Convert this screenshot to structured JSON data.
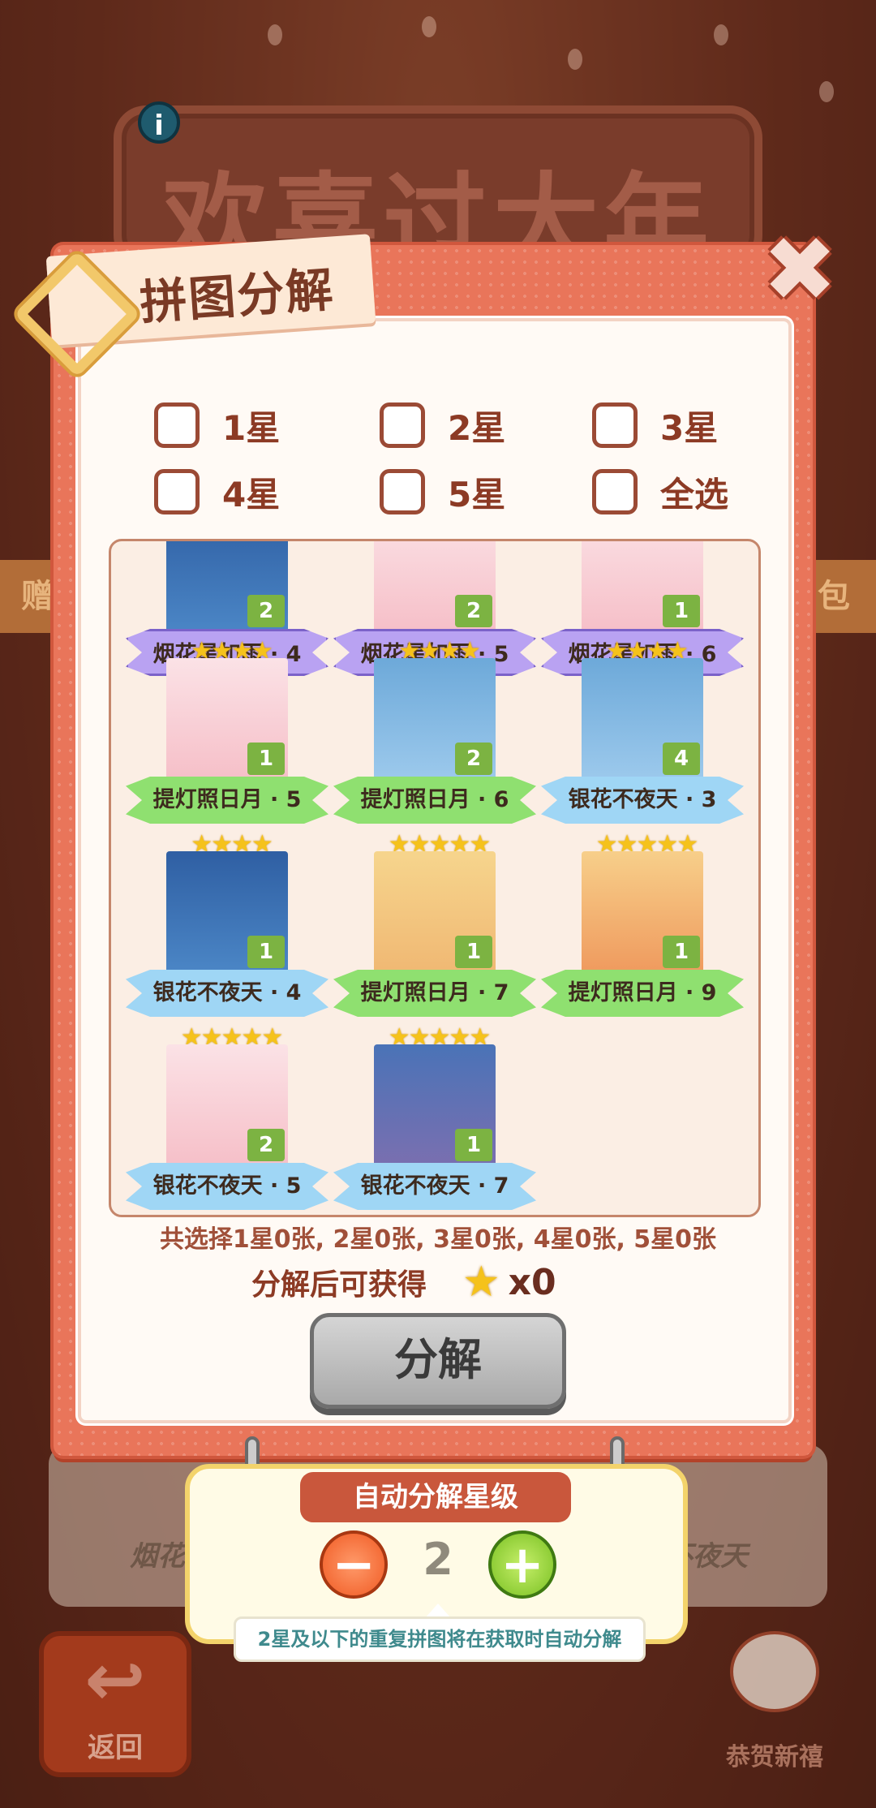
{
  "background": {
    "banner_title": "欢喜过大年",
    "info_icon": "i",
    "strip_left": "赠",
    "strip_right": "包",
    "card_label_left": "烟花星",
    "card_label_right": "不夜天",
    "back_label": "返回",
    "mascot_label": "恭贺新禧"
  },
  "modal": {
    "title": "拼图分解",
    "close_icon": "✖",
    "checkboxes": [
      {
        "label": "1星",
        "checked": false
      },
      {
        "label": "2星",
        "checked": false
      },
      {
        "label": "3星",
        "checked": false
      },
      {
        "label": "4星",
        "checked": false
      },
      {
        "label": "5星",
        "checked": false
      },
      {
        "label": "全选",
        "checked": false
      }
    ],
    "cards": [
      {
        "name": "烟花星如雨 · 4",
        "stars": "",
        "count": "2",
        "ribbon": "purple",
        "art": "night"
      },
      {
        "name": "烟花星如雨 · 5",
        "stars": "",
        "count": "2",
        "ribbon": "purple",
        "art": "pink"
      },
      {
        "name": "烟花星如雨 · 6",
        "stars": "",
        "count": "1",
        "ribbon": "purple",
        "art": "pink"
      },
      {
        "name": "提灯照日月 · 5",
        "stars": "★★★★",
        "count": "1",
        "ribbon": "green",
        "art": "pink"
      },
      {
        "name": "提灯照日月 · 6",
        "stars": "★★★★",
        "count": "2",
        "ribbon": "green",
        "art": "sky"
      },
      {
        "name": "银花不夜天 · 3",
        "stars": "★★★★",
        "count": "4",
        "ribbon": "blue",
        "art": "sky"
      },
      {
        "name": "银花不夜天 · 4",
        "stars": "★★★★",
        "count": "1",
        "ribbon": "blue",
        "art": "night"
      },
      {
        "name": "提灯照日月 · 7",
        "stars": "★★★★★",
        "count": "1",
        "ribbon": "green",
        "art": "warm"
      },
      {
        "name": "提灯照日月 · 9",
        "stars": "★★★★★",
        "count": "1",
        "ribbon": "green",
        "art": "lantern"
      },
      {
        "name": "银花不夜天 · 5",
        "stars": "★★★★★",
        "count": "2",
        "ribbon": "blue",
        "art": "pink"
      },
      {
        "name": "银花不夜天 · 7",
        "stars": "★★★★★",
        "count": "1",
        "ribbon": "blue",
        "art": "dusk"
      }
    ],
    "summary": "共选择1星0张, 2星0张, 3星0张, 4星0张, 5星0张",
    "reward_label": "分解后可获得",
    "reward_icon": "★",
    "reward_count": "x0",
    "decompose_label": "分解"
  },
  "auto_decompose": {
    "title": "自动分解星级",
    "minus": "−",
    "plus": "+",
    "value": "2",
    "tip": "2星及以下的重复拼图将在获取时自动分解"
  },
  "colors": {
    "modal_bg": "#e9755a",
    "accent_purple": "#b9a2f2",
    "accent_green": "#8fe070",
    "accent_blue": "#9fd6f5",
    "star": "#f5c21b"
  }
}
